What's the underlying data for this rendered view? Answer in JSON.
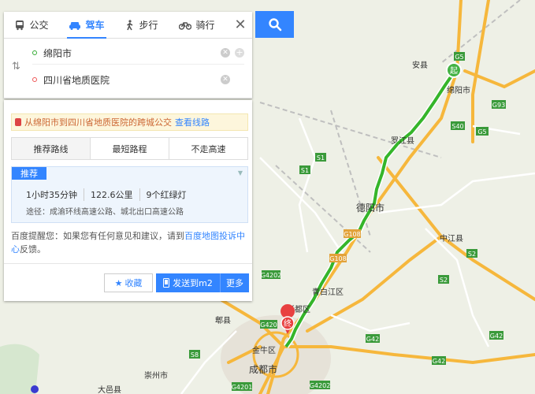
{
  "modes": [
    {
      "label": "公交",
      "icon": "bus-icon"
    },
    {
      "label": "驾车",
      "icon": "car-icon",
      "active": true
    },
    {
      "label": "步行",
      "icon": "walk-icon"
    },
    {
      "label": "骑行",
      "icon": "bike-icon"
    }
  ],
  "route": {
    "start": "绵阳市",
    "end": "四川省地质医院"
  },
  "bus_tip": {
    "text": "从绵阳市到四川省地质医院的跨城公交",
    "link": "查看线路"
  },
  "tabs": [
    "推荐路线",
    "最短路程",
    "不走高速"
  ],
  "plan": {
    "badge": "推荐",
    "duration": "1小时35分钟",
    "distance": "122.6公里",
    "lights": "9个红绿灯",
    "via": "途径：成渝环线高速公路、城北出口高速公路"
  },
  "feedback": {
    "text": "百度提醒您：如果您有任何意见和建议，请到",
    "link": "百度地图投诉中心",
    "tail": "反馈。"
  },
  "actions": {
    "favorite": "收藏",
    "send": "发送到m2",
    "more": "更多"
  },
  "map": {
    "places": [
      "安县",
      "绵阳市",
      "罗江县",
      "德阳市",
      "中江县",
      "青白江区",
      "新都区",
      "郫县",
      "金牛区",
      "成都市",
      "崇州市",
      "大邑县"
    ],
    "roads": [
      "G5",
      "G93",
      "S40",
      "S1",
      "G5",
      "S1",
      "G108",
      "G108",
      "S2",
      "G42",
      "S2",
      "G4202",
      "G420",
      "S8",
      "G42",
      "G4201",
      "G4202",
      "G42"
    ],
    "start_marker": "起",
    "end_marker": "终",
    "colors": {
      "route": "#35b52a",
      "highway": "#f6b73c",
      "road": "#ffffff",
      "accent": "#3385ff"
    }
  }
}
